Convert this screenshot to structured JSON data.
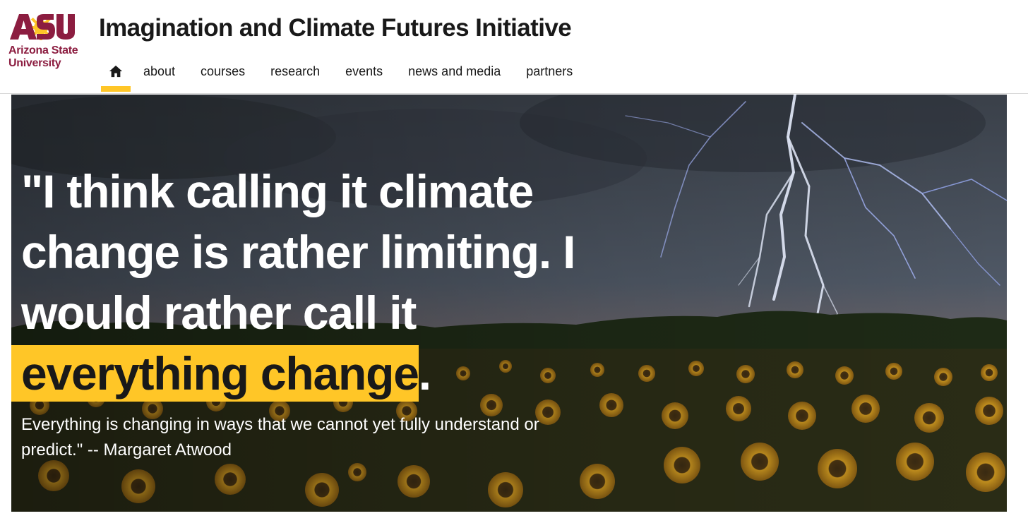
{
  "logo": {
    "mark_text": "ASU",
    "name_line1": "Arizona State",
    "name_line2": "University",
    "brand_color": "#8c1d40",
    "accent_color": "#ffc627"
  },
  "header": {
    "title": "Imagination and Climate Futures Initiative"
  },
  "nav": {
    "home_icon": "home-icon",
    "items": [
      {
        "label": "about"
      },
      {
        "label": "courses"
      },
      {
        "label": "research"
      },
      {
        "label": "events"
      },
      {
        "label": "news and media"
      },
      {
        "label": "partners"
      }
    ],
    "active_color": "#ffc627"
  },
  "hero": {
    "image_content": [
      "lightning-storm",
      "sunflower-field"
    ],
    "headline": {
      "line1": "\"I think calling it climate",
      "line2": "change is rather limiting. I",
      "line3": "would rather call it",
      "highlight": "everything change",
      "highlight_end": "."
    },
    "subtext": {
      "line1": "Everything is changing in ways that we cannot yet fully understand or",
      "line2": "predict.\" -- Margaret Atwood"
    }
  }
}
